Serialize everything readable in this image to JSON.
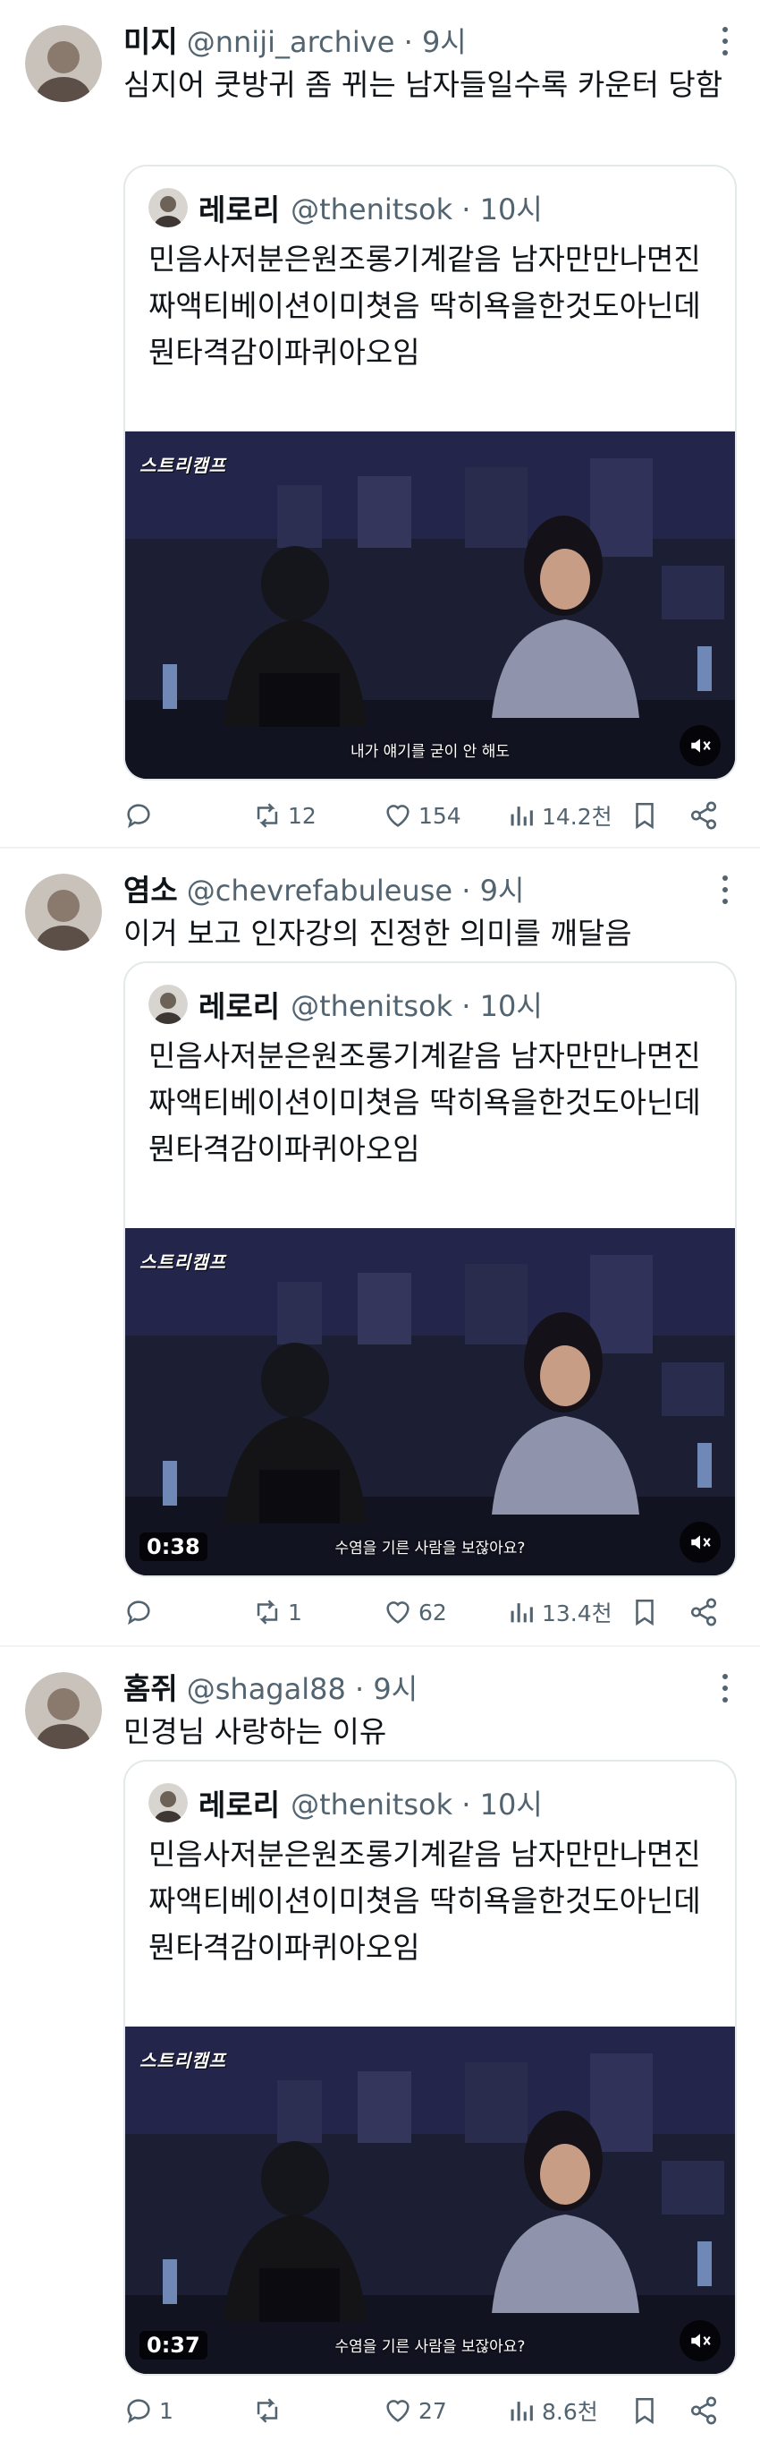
{
  "tweets": [
    {
      "name": "미지",
      "handle": "@nniji_archive · 9시",
      "text": "심지어 쿳방귀 좀 뀌는 남자들일수록 카운터 당함",
      "quote": {
        "name": "레로리",
        "handle": "@thenitsok · 10시",
        "text": "민음사저분은원조롱기계같음 남자만만나면진짜액티베이션이미쳣음 딱히욕을한것도아닌데뭔타격감이파퀴아오임"
      },
      "video": {
        "logo": "스트리캠프",
        "subtitle": "내가 얘기를 굳이 안 해도",
        "duration": ""
      },
      "stats": {
        "replies": "",
        "retweets": "12",
        "likes": "154",
        "views": "14.2천"
      }
    },
    {
      "name": "염소",
      "handle": "@chevrefabuleuse · 9시",
      "text": "이거 보고 인자강의 진정한 의미를 깨달음",
      "quote": {
        "name": "레로리",
        "handle": "@thenitsok · 10시",
        "text": "민음사저분은원조롱기계같음 남자만만나면진짜액티베이션이미쳣음 딱히욕을한것도아닌데뭔타격감이파퀴아오임"
      },
      "video": {
        "logo": "스트리캠프",
        "subtitle": "수염을 기른 사람을 보잖아요?",
        "duration": "0:38"
      },
      "stats": {
        "replies": "",
        "retweets": "1",
        "likes": "62",
        "views": "13.4천"
      }
    },
    {
      "name": "홈쥐",
      "handle": "@shagal88 · 9시",
      "text": "민경님 사랑하는 이유",
      "quote": {
        "name": "레로리",
        "handle": "@thenitsok · 10시",
        "text": "민음사저분은원조롱기계같음 남자만만나면진짜액티베이션이미쳣음 딱히욕을한것도아닌데뭔타격감이파퀴아오임"
      },
      "video": {
        "logo": "스트리캠프",
        "subtitle": "수염을 기른 사람을 보잖아요?",
        "duration": "0:37"
      },
      "stats": {
        "replies": "1",
        "retweets": "",
        "likes": "27",
        "views": "8.6천"
      }
    }
  ],
  "colors": {
    "text": "#0f1419",
    "secondary": "#536471",
    "border": "#e3e8eb"
  }
}
